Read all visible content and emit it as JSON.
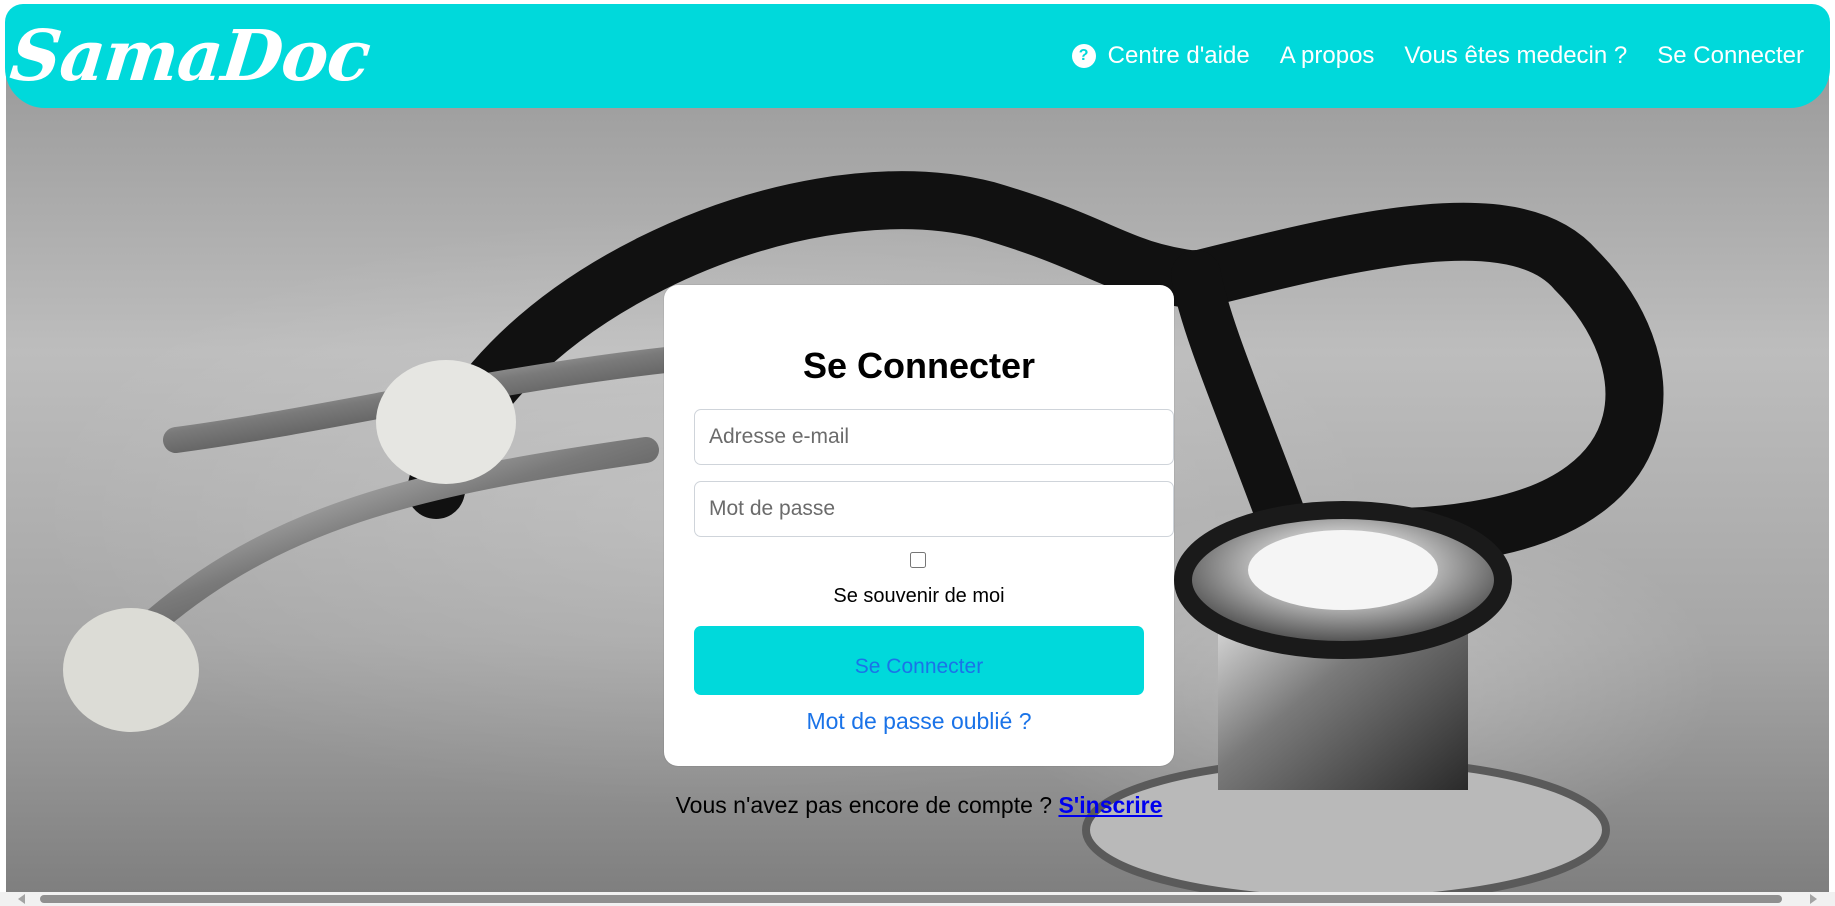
{
  "brand": {
    "name": "SamaDoc",
    "accent_color": "#00d9db",
    "link_color": "#1a73e8"
  },
  "navbar": {
    "help_icon": "question-circle-icon",
    "items": [
      {
        "label": "Centre d'aide"
      },
      {
        "label": "A propos"
      },
      {
        "label": "Vous êtes medecin ?"
      },
      {
        "label": "Se Connecter"
      }
    ]
  },
  "login": {
    "title": "Se Connecter",
    "email_placeholder": "Adresse e-mail",
    "password_placeholder": "Mot de passe",
    "remember_label": "Se souvenir de moi",
    "remember_checked": false,
    "submit_label": "Se Connecter",
    "forgot_label": "Mot de passe oublié ?"
  },
  "signup": {
    "prompt": "Vous n'avez pas encore de compte ? ",
    "link_label": "S'inscrire"
  }
}
